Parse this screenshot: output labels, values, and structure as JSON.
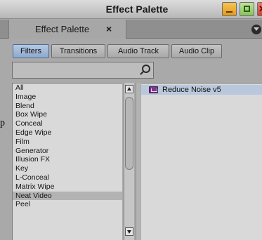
{
  "window": {
    "title": "Effect Palette"
  },
  "tab": {
    "label": "Effect Palette",
    "close": "×"
  },
  "categories": [
    {
      "label": "Filters",
      "active": true
    },
    {
      "label": "Transitions",
      "active": false
    },
    {
      "label": "Audio Track",
      "active": false
    },
    {
      "label": "Audio Clip",
      "active": false
    }
  ],
  "search": {
    "value": "",
    "placeholder": ""
  },
  "category_list": [
    "All",
    "Image",
    "Blend",
    "Box Wipe",
    "Conceal",
    "Edge Wipe",
    "Film",
    "Generator",
    "Illusion FX",
    "Key",
    "L-Conceal",
    "Matrix Wipe",
    "Neat Video",
    "Peel"
  ],
  "selected_category": "Neat Video",
  "effects": [
    {
      "label": "Reduce Noise v5",
      "icon": "effect-icon"
    }
  ],
  "outside_fragment": "p",
  "colors": {
    "selected_category_bg": "#b3b3b3",
    "selected_effect_bg": "#b9c8dc",
    "active_category_button": "#8fa9cc"
  }
}
